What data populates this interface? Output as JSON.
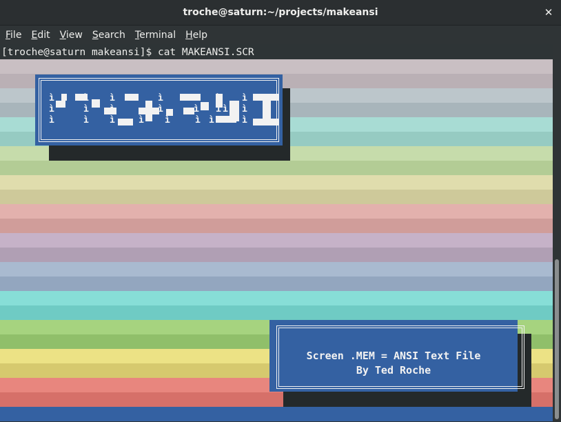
{
  "window": {
    "title": "troche@saturn:~/projects/makeansi",
    "close_glyph": "✕"
  },
  "menu": [
    {
      "mnemonic": "F",
      "rest": "ile"
    },
    {
      "mnemonic": "E",
      "rest": "dit"
    },
    {
      "mnemonic": "V",
      "rest": "iew"
    },
    {
      "mnemonic": "S",
      "rest": "earch"
    },
    {
      "mnemonic": "T",
      "rest": "erminal"
    },
    {
      "mnemonic": "H",
      "rest": "elp"
    }
  ],
  "terminal": {
    "prompt": "[troche@saturn makeansi]$ cat MAKEANSI.SCR",
    "stripe_colors": [
      "#c9bfc3",
      "#bab0b5",
      "#bcc6cb",
      "#a8b5bb",
      "#a8dcd4",
      "#96cbc2",
      "#c6dcab",
      "#b3cc95",
      "#e0ddad",
      "#cec99a",
      "#e3b1ad",
      "#d09d9a",
      "#c6b2c8",
      "#b09fb4",
      "#a9bad0",
      "#93a6bf",
      "#87ded7",
      "#6fcbc4",
      "#a6d37f",
      "#90bf6a",
      "#ece285",
      "#d6c96e",
      "#e8867e",
      "#d67069",
      "#3461a2"
    ],
    "logo_glyph": "ì",
    "info_box": {
      "line1": "Screen .MEM = ANSI Text File",
      "line2": "By Ted Roche"
    }
  },
  "colors": {
    "box_blue": "#3461a2",
    "box_text": "#f2f2f2",
    "shadow": "#24292a"
  }
}
